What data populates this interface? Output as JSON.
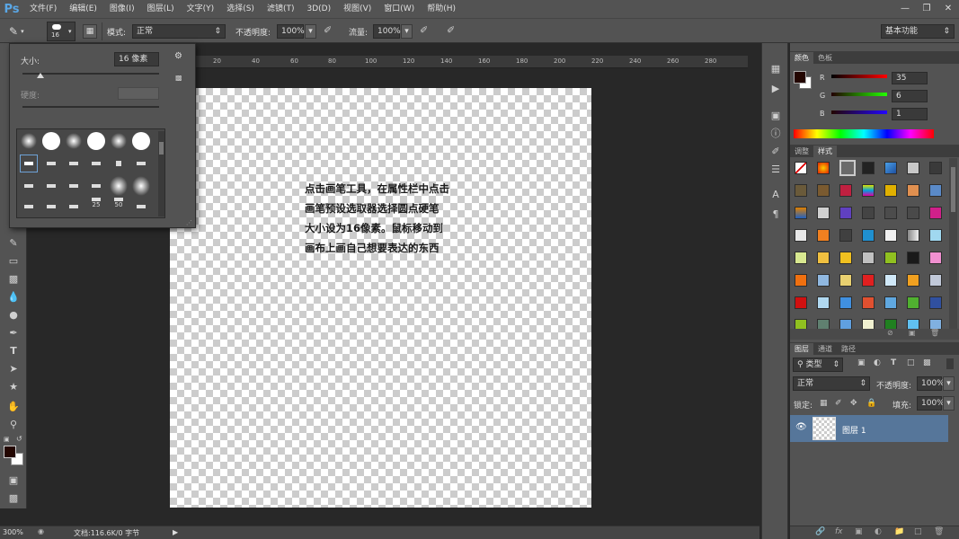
{
  "app": {
    "logo": "Ps"
  },
  "menu": [
    "文件(F)",
    "编辑(E)",
    "图像(I)",
    "图层(L)",
    "文字(Y)",
    "选择(S)",
    "滤镜(T)",
    "3D(D)",
    "视图(V)",
    "窗口(W)",
    "帮助(H)"
  ],
  "options_bar": {
    "brush_size": "16",
    "mode_label": "模式:",
    "mode_value": "正常",
    "opacity_label": "不透明度:",
    "opacity_value": "100%",
    "flow_label": "流量:",
    "flow_value": "100%",
    "workspace": "基本功能"
  },
  "brush_popup": {
    "size_label": "大小:",
    "size_value": "16 像素",
    "hardness_label": "硬度:",
    "thumb_labels": [
      "25",
      "50"
    ]
  },
  "canvas_note": [
    "点击画笔工具，在属性栏中点击",
    "画笔预设选取器选择圆点硬笔",
    "大小设为16像素。鼠标移动到",
    "画布上画自己想要表达的东西"
  ],
  "ruler_ticks": [
    "20",
    "40",
    "60",
    "80",
    "100",
    "120",
    "140",
    "160",
    "180",
    "200",
    "220",
    "240",
    "260",
    "280"
  ],
  "status": {
    "zoom": "300%",
    "doc": "文档:116.6K/0 字节"
  },
  "color_panel": {
    "tabs": [
      "颜色",
      "色板"
    ],
    "r_label": "R",
    "g_label": "G",
    "b_label": "B",
    "r": "35",
    "g": "6",
    "b": "1",
    "fg_color": "#230601"
  },
  "styles_panel": {
    "tabs": [
      "调整",
      "样式"
    ]
  },
  "layers_panel": {
    "tabs": [
      "图层",
      "通道",
      "路径"
    ],
    "filter_label": "类型",
    "blend": "正常",
    "opacity_label": "不透明度:",
    "opacity": "100%",
    "lock_label": "锁定:",
    "fill_label": "填充:",
    "fill": "100%",
    "layer_name": "图层 1"
  }
}
